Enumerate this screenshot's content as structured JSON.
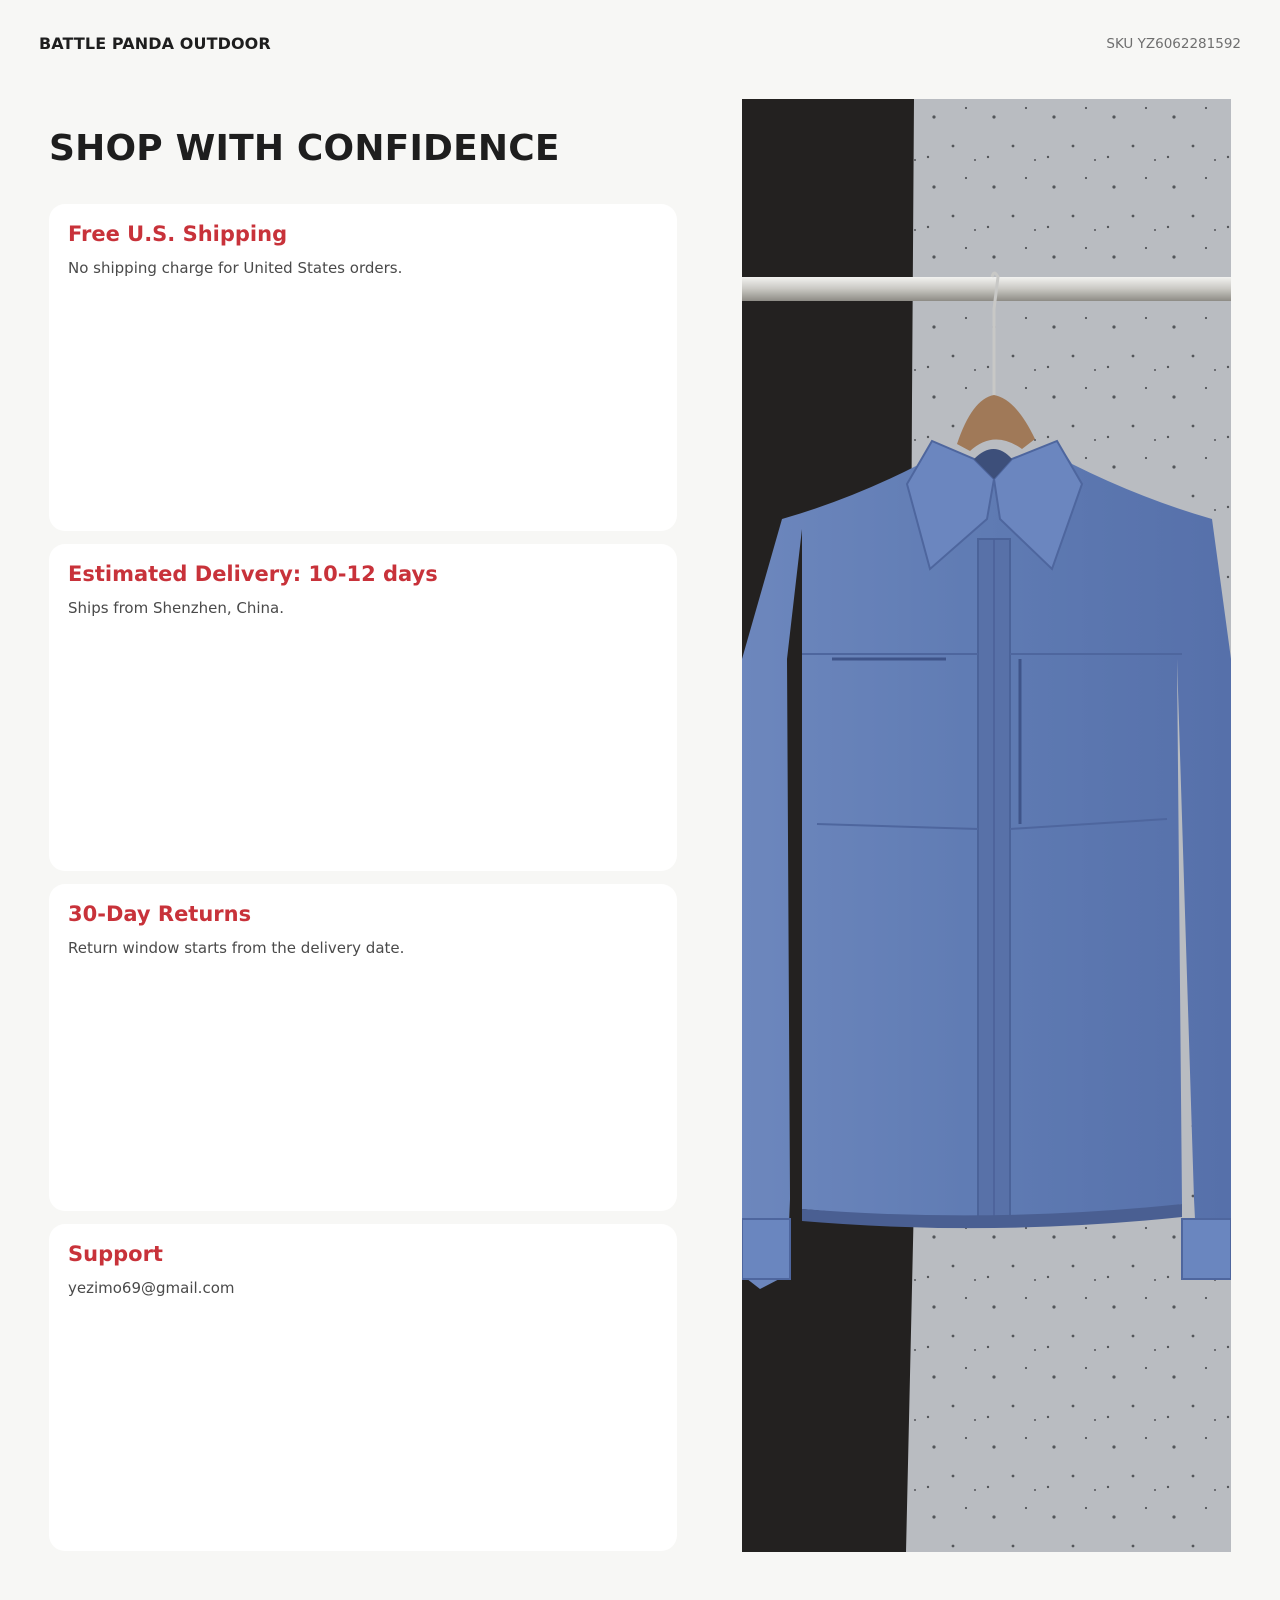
{
  "header": {
    "brand": "BATTLE PANDA OUTDOOR",
    "sku": "SKU YZ6062281592"
  },
  "main": {
    "headline": "SHOP WITH CONFIDENCE",
    "cards": [
      {
        "title": "Free U.S. Shipping",
        "text": "No shipping charge for United States orders."
      },
      {
        "title": "Estimated Delivery: 10-12 days",
        "text": "Ships from Shenzhen, China."
      },
      {
        "title": "30-Day Returns",
        "text": "Return window starts from the delivery date."
      },
      {
        "title": "Support",
        "text": "yezimo69@gmail.com"
      }
    ]
  },
  "product_image": {
    "icon": "shirt-jacket-photo",
    "colors": {
      "jacket": "#5f7bb3",
      "wall_dark": "#232120",
      "wall_light": "#b9bcc1"
    }
  },
  "colors": {
    "accent": "#c8323a",
    "background": "#f7f7f5",
    "card": "#ffffff"
  }
}
